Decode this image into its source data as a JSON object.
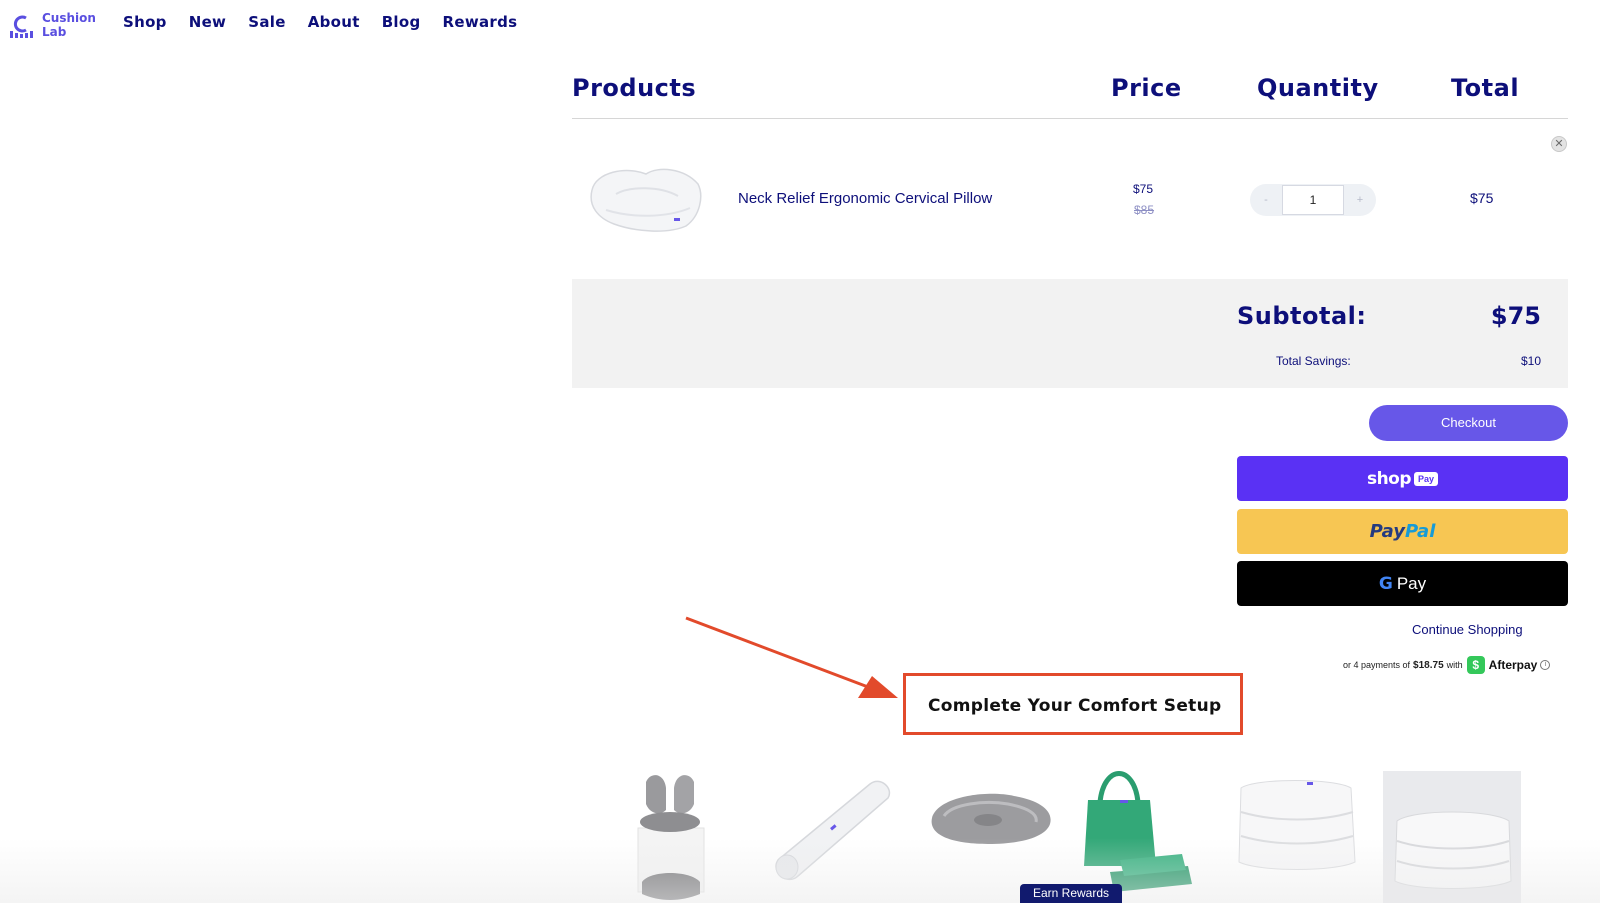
{
  "brand": {
    "name_line1": "Cushion",
    "name_line2": "Lab",
    "color": "#5a4fe0"
  },
  "nav": {
    "items": [
      "Shop",
      "New",
      "Sale",
      "About",
      "Blog",
      "Rewards"
    ]
  },
  "cart": {
    "headers": {
      "products": "Products",
      "price": "Price",
      "quantity": "Quantity",
      "total": "Total"
    },
    "item": {
      "name": "Neck Relief Ergonomic Cervical Pillow",
      "price": "$75",
      "compare_price": "$85",
      "quantity": "1",
      "minus": "-",
      "plus": "+",
      "line_total": "$75",
      "remove_icon": "close-icon"
    },
    "subtotal_label": "Subtotal:",
    "subtotal_value": "$75",
    "savings_label": "Total Savings:",
    "savings_value": "$10"
  },
  "actions": {
    "checkout": "Checkout",
    "shop_pay_word": "shop",
    "shop_pay_badge": "Pay",
    "paypal_pay": "Pay",
    "paypal_pal": "Pal",
    "gpay_g": "G",
    "gpay_pay": "Pay",
    "continue": "Continue Shopping"
  },
  "afterpay": {
    "prefix": "or 4 payments of",
    "amount": "$18.75",
    "suffix": "with",
    "icon": "$",
    "brand": "Afterpay",
    "info": "i"
  },
  "recommendations": {
    "title": "Complete Your Comfort Setup",
    "items": [
      "seat-cushion-set",
      "body-pillow",
      "seat-cushion",
      "green-tote-bundle",
      "white-comforter",
      "white-comforter-folded"
    ]
  },
  "rewards": {
    "label": "Earn Rewards"
  },
  "colors": {
    "navy": "#0d0f7a",
    "accent": "#6757e8",
    "shop_pay": "#5a31f4",
    "paypal": "#f7c653",
    "annotation": "#e24a2b"
  }
}
